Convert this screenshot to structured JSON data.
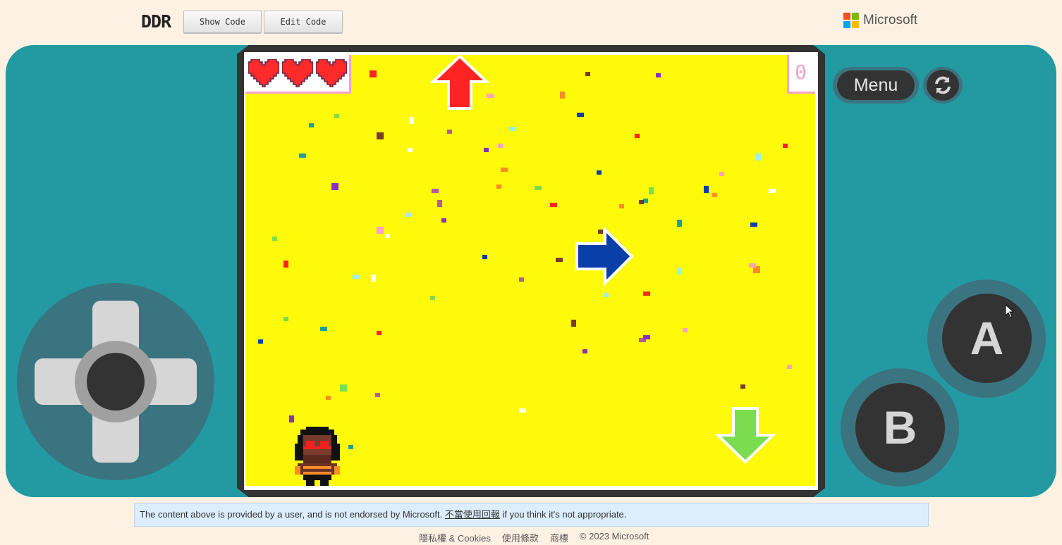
{
  "header": {
    "title": "DDR",
    "show_code_label": "Show Code",
    "edit_code_label": "Edit Code",
    "brand": "Microsoft"
  },
  "colors": {
    "console": "#239aa2",
    "stage": "#fff90a",
    "hud_border": "#f7a1c8",
    "heart": "#ff2a2a",
    "arrow_up": "#ff2424",
    "arrow_right": "#0a3fa8",
    "arrow_down": "#7cdc50"
  },
  "game": {
    "lives": 3,
    "score": "0",
    "icons": [
      "heart-icon",
      "arrow-up-icon",
      "arrow-right-icon",
      "arrow-down-icon",
      "player-sprite"
    ]
  },
  "controls": {
    "menu_label": "Menu",
    "a_label": "A",
    "b_label": "B",
    "reset_icon": "refresh-icon",
    "dpad_icon": "dpad"
  },
  "notice": {
    "text_before": "The content above is provided by a user, and is not endorsed by Microsoft. ",
    "link_text": "不當使用回報",
    "text_after": " if you think it's not appropriate."
  },
  "footer": {
    "items": [
      "隱私權 & Cookies",
      "使用條款",
      "商標",
      "© 2023 Microsoft"
    ]
  }
}
